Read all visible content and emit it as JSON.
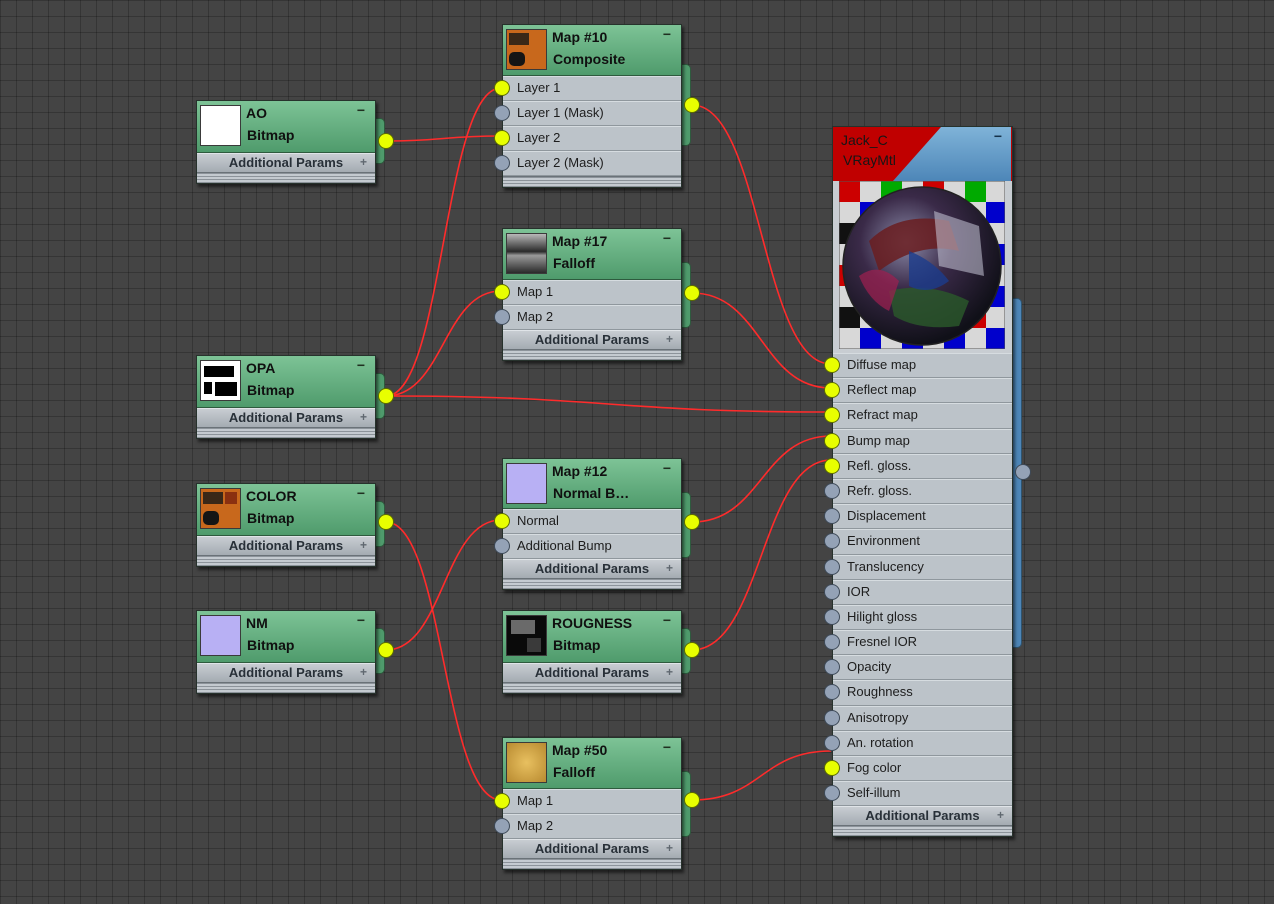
{
  "nodes": {
    "ao": {
      "name": "AO",
      "type": "Bitmap",
      "params": "Additional Params"
    },
    "opa": {
      "name": "OPA",
      "type": "Bitmap",
      "params": "Additional Params"
    },
    "color": {
      "name": "COLOR",
      "type": "Bitmap",
      "params": "Additional Params"
    },
    "nm": {
      "name": "NM",
      "type": "Bitmap",
      "params": "Additional Params"
    },
    "map10": {
      "name": "Map #10",
      "type": "Composite",
      "inputs": [
        "Layer 1",
        "Layer 1 (Mask)",
        "Layer 2",
        "Layer 2 (Mask)"
      ]
    },
    "map17": {
      "name": "Map #17",
      "type": "Falloff",
      "inputs": [
        "Map 1",
        "Map 2"
      ],
      "params": "Additional Params"
    },
    "map12": {
      "name": "Map #12",
      "type": "Normal  B…",
      "inputs": [
        "Normal",
        "Additional Bump"
      ],
      "params": "Additional Params"
    },
    "roug": {
      "name": "ROUGNESS",
      "type": "Bitmap",
      "params": "Additional Params"
    },
    "map50": {
      "name": "Map #50",
      "type": "Falloff",
      "inputs": [
        "Map 1",
        "Map 2"
      ],
      "params": "Additional Params"
    },
    "jack": {
      "name": "Jack_C",
      "type": "VRayMtl",
      "params": "Additional Params",
      "inputs": [
        "Diffuse map",
        "Reflect map",
        "Refract map",
        "Bump map",
        "Refl. gloss.",
        "Refr. gloss.",
        "Displacement",
        "Environment",
        "Translucency",
        "IOR",
        "Hilight gloss",
        "Fresnel IOR",
        "Opacity",
        "Roughness",
        "Anisotropy",
        "An. rotation",
        "Fog color",
        "Self-illum"
      ],
      "connected": [
        0,
        1,
        2,
        3,
        4,
        16
      ]
    }
  },
  "ui": {
    "collapse_symbol": "−",
    "expand_symbol": "+"
  },
  "colors": {
    "wire": "#ff2b2b",
    "socket_on": "#e8ff00",
    "socket_off": "#94a2b6",
    "node_header": "#5aa877",
    "material_header_red": "#c00000",
    "material_header_blue": "#5a93c4"
  },
  "icons": [
    "bitmap-thumbnail",
    "sphere-material-preview",
    "collapse-icon",
    "expand-icon"
  ]
}
